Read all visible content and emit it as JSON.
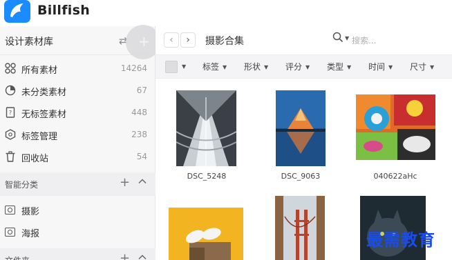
{
  "app": {
    "name": "Billfish"
  },
  "sidebar": {
    "library_title": "设计素材库",
    "items": [
      {
        "label": "所有素材",
        "count": "14264",
        "icon": "grid-icon"
      },
      {
        "label": "未分类素材",
        "count": "67",
        "icon": "pie-icon"
      },
      {
        "label": "无标签素材",
        "count": "448",
        "icon": "untagged-icon"
      },
      {
        "label": "标签管理",
        "count": "238",
        "icon": "tag-icon"
      },
      {
        "label": "回收站",
        "count": "54",
        "icon": "trash-icon"
      }
    ],
    "smart_title": "智能分类",
    "folders": [
      {
        "label": "摄影"
      },
      {
        "label": "海报"
      }
    ],
    "folders_title": "文件夹"
  },
  "toolbar": {
    "current_folder": "摄影合集",
    "search_placeholder": "搜索..."
  },
  "filters": [
    "标签",
    "形状",
    "评分",
    "类型",
    "时间",
    "尺寸"
  ],
  "assets": [
    {
      "name": "DSC_5248"
    },
    {
      "name": "DSC_9063"
    },
    {
      "name": "040622aHc"
    },
    {
      "name": ""
    },
    {
      "name": ""
    },
    {
      "name": ""
    }
  ],
  "watermark": "最需教育",
  "colors": {
    "brand": "#1a8cff",
    "watermark": "#1a4ce8"
  }
}
